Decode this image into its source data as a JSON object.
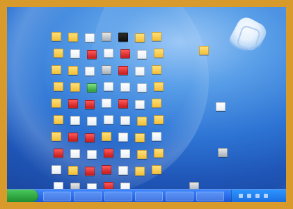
{
  "desktop": {
    "background_palette": {
      "frame": "#d89a2b",
      "wallpaper_top": "#9cc8f6",
      "wallpaper_mid": "#2d74d4",
      "wallpaper_bottom": "#1a47a0",
      "taskbar": "#1c57d6",
      "start": "#1f8e2e"
    },
    "icons": [
      {
        "type": "folder"
      },
      {
        "type": "folder"
      },
      {
        "type": "doc"
      },
      {
        "type": "gray"
      },
      {
        "type": "dark"
      },
      {
        "type": "folder"
      },
      {
        "type": "folder"
      },
      {
        "type": "folder"
      },
      {
        "type": "doc"
      },
      {
        "type": "red"
      },
      {
        "type": "doc"
      },
      {
        "type": "red"
      },
      {
        "type": "doc"
      },
      {
        "type": "folder"
      },
      {
        "type": "folder"
      },
      {
        "type": "folder"
      },
      {
        "type": "doc"
      },
      {
        "type": "gray"
      },
      {
        "type": "red"
      },
      {
        "type": "doc"
      },
      {
        "type": "folder"
      },
      {
        "type": "folder"
      },
      {
        "type": "folder"
      },
      {
        "type": "green"
      },
      {
        "type": "doc"
      },
      {
        "type": "doc"
      },
      {
        "type": "doc"
      },
      {
        "type": "folder"
      },
      {
        "type": "folder"
      },
      {
        "type": "red"
      },
      {
        "type": "red"
      },
      {
        "type": "doc"
      },
      {
        "type": "red"
      },
      {
        "type": "doc"
      },
      {
        "type": "folder"
      },
      {
        "type": "folder"
      },
      {
        "type": "doc"
      },
      {
        "type": "doc"
      },
      {
        "type": "doc"
      },
      {
        "type": "doc"
      },
      {
        "type": "folder"
      },
      {
        "type": "folder"
      },
      {
        "type": "folder"
      },
      {
        "type": "red"
      },
      {
        "type": "red"
      },
      {
        "type": "folder"
      },
      {
        "type": "doc"
      },
      {
        "type": "folder"
      },
      {
        "type": "doc"
      },
      {
        "type": "red"
      },
      {
        "type": "doc"
      },
      {
        "type": "doc"
      },
      {
        "type": "red"
      },
      {
        "type": "doc"
      },
      {
        "type": "folder"
      },
      {
        "type": "folder"
      },
      {
        "type": "doc"
      },
      {
        "type": "folder"
      },
      {
        "type": "red"
      },
      {
        "type": "red"
      },
      {
        "type": "doc"
      },
      {
        "type": "folder"
      },
      {
        "type": "folder"
      },
      {
        "type": "doc"
      },
      {
        "type": "gray"
      },
      {
        "type": "doc"
      },
      {
        "type": "red"
      },
      {
        "type": "doc"
      }
    ],
    "extra_icons": [
      {
        "type": "folder"
      },
      {
        "type": "doc"
      },
      {
        "type": "gray"
      },
      {
        "type": "gray"
      }
    ],
    "taskbar": {
      "slots": [
        {
          "label": ""
        },
        {
          "label": ""
        },
        {
          "label": ""
        },
        {
          "label": ""
        },
        {
          "label": ""
        },
        {
          "label": ""
        }
      ]
    }
  }
}
